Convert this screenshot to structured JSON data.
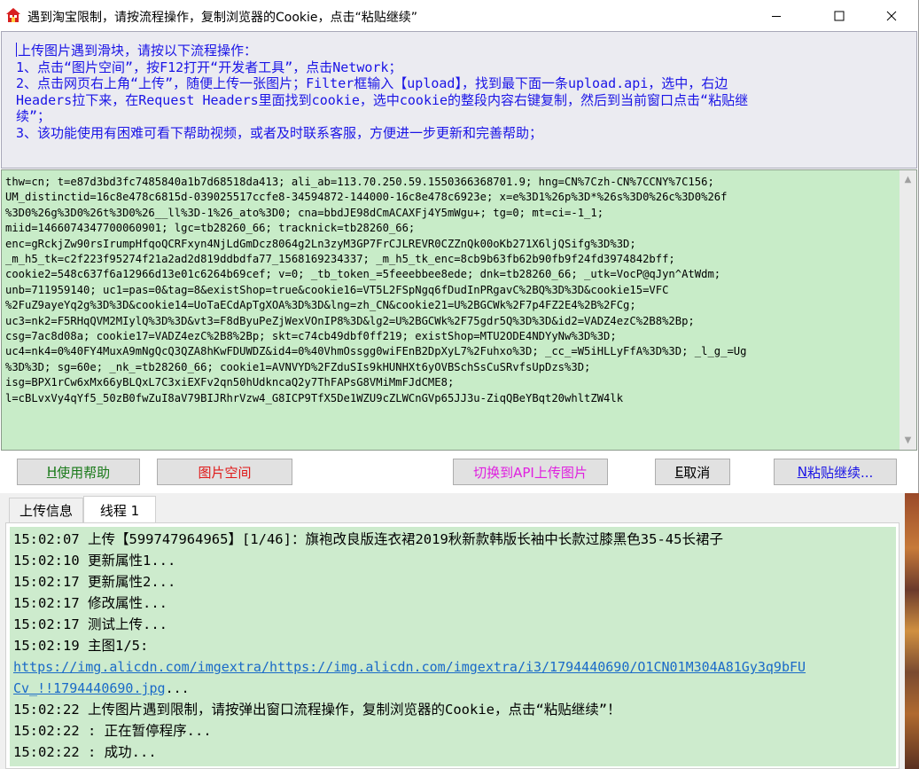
{
  "window": {
    "title": "遇到淘宝限制，请按流程操作，复制浏览器的Cookie，点击“粘贴继续”",
    "minimize_glyph": "—",
    "maximize_glyph": "☐",
    "close_glyph": "✕"
  },
  "instructions": {
    "line1": "上传图片遇到滑块，请按以下流程操作：",
    "line2": "1、点击“图片空间”，按F12打开“开发者工具”，点击Network；",
    "line3": "2、点击网页右上角“上传”，随便上传一张图片；Filter框输入【upload】，找到最下面一条upload.api，选中，右边",
    "line4": "Headers拉下来，在Request Headers里面找到cookie，选中cookie的整段内容右键复制，然后到当前窗口点击“粘贴继",
    "line5": "续”；",
    "line6": "3、该功能使用有困难可看下帮助视频，或者及时联系客服，方便进一步更新和完善帮助；"
  },
  "cookie_text": "thw=cn; t=e87d3bd3fc7485840a1b7d68518da413; ali_ab=113.70.250.59.1550366368701.9; hng=CN%7Czh-CN%7CCNY%7C156;\nUM_distinctid=16c8e478c6815d-039025517ccfe8-34594872-144000-16c8e478c6923e; x=e%3D1%26p%3D*%26s%3D0%26c%3D0%26f\n%3D0%26g%3D0%26t%3D0%26__ll%3D-1%26_ato%3D0; cna=bbdJE98dCmACAXFj4Y5mWgu+; tg=0; mt=ci=-1_1;\nmiid=1466074347700060901; lgc=tb28260_66; tracknick=tb28260_66;\nenc=gRckjZw90rsIrumpHfqoQCRFxyn4NjLdGmDcz8064g2Ln3zyM3GP7FrCJLREVR0CZZnQk00oKb271X6ljQSifg%3D%3D;\n_m_h5_tk=c2f223f95274f21a2ad2d819ddbdfa77_1568169234337; _m_h5_tk_enc=8cb9b63fb62b90fb9f24fd3974842bff;\ncookie2=548c637f6a12966d13e01c6264b69cef; v=0; _tb_token_=5feeebbee8ede; dnk=tb28260_66; _utk=VocP@qJyn^AtWdm;\nunb=711959140; uc1=pas=0&tag=8&existShop=true&cookie16=VT5L2FSpNgq6fDudInPRgavC%2BQ%3D%3D&cookie15=VFC\n%2FuZ9ayeYq2g%3D%3D&cookie14=UoTaECdApTgXOA%3D%3D&lng=zh_CN&cookie21=U%2BGCWk%2F7p4FZ2E4%2B%2FCg;\nuc3=nk2=F5RHqQVM2MIylQ%3D%3D&vt3=F8dByuPeZjWexVOnIP8%3D&lg2=U%2BGCWk%2F75gdr5Q%3D%3D&id2=VADZ4ezC%2B8%2Bp;\ncsg=7ac8d08a; cookie17=VADZ4ezC%2B8%2Bp; skt=c74cb49dbf0ff219; existShop=MTU2ODE4NDYyNw%3D%3D;\nuc4=nk4=0%40FY4MuxA9mNgQcQ3QZA8hKwFDUWDZ&id4=0%40VhmOssgg0wiFEnB2DpXyL7%2Fuhxo%3D; _cc_=W5iHLLyFfA%3D%3D; _l_g_=Ug\n%3D%3D; sg=60e; _nk_=tb28260_66; cookie1=AVNVYD%2FZduSIs9kHUNHXt6yOVBSchSsCuSRvfsUpDzs%3D;\nisg=BPX1rCw6xMx66yBLQxL7C3xiEXFv2qn50hUdkncaQ2y7ThFAPsG8VMiMmFJdCME8;\nl=cBLvxVy4qYf5_50zB0fwZuI8aV79BIJRhrVzw4_G8ICP9TfX5De1WZU9cZLWCnGVp65JJ3u-ZiqQBeYBqt20whltZW4lk",
  "buttons": {
    "help": {
      "hotkey": "H",
      "label": "使用帮助"
    },
    "picspace": {
      "label": "图片空间"
    },
    "switch_api": {
      "label": "切换到API上传图片"
    },
    "cancel": {
      "hotkey": "E",
      "label": "取消"
    },
    "paste": {
      "hotkey": "N",
      "label": "粘贴继续..."
    }
  },
  "tabs": [
    {
      "label": "上传信息"
    },
    {
      "label": "线程 1"
    }
  ],
  "log": [
    "15:02:07 上传【599747964965】[1/46]：旗袍改良版连衣裙2019秋新款韩版长袖中长款过膝黑色35-45长裙子",
    "15:02:10 更新属性1...",
    "15:02:17 更新属性2...",
    "15:02:17 修改属性...",
    "15:02:17 测试上传...",
    "15:02:19 主图1/5:"
  ],
  "log_link_line1": "https://img.alicdn.com/imgextra/https://img.alicdn.com/imgextra/i3/1794440690/O1CN01M304A81Gy3q9bFU",
  "log_link_line2": "Cv_!!1794440690.jpg",
  "log_link_suffix": "...",
  "log_after": [
    "15:02:22 上传图片遇到限制，请按弹出窗口流程操作，复制浏览器的Cookie，点击“粘贴继续”！",
    "15:02:22 : 正在暂停程序...",
    "15:02:22 : 成功..."
  ],
  "colors": {
    "instruction_text": "#1a14e6",
    "cookie_bg": "#c8ecc8",
    "log_bg": "#cdebcd",
    "help_text": "#1a7a1a",
    "picspace_text": "#e01818",
    "switch_text": "#e020e0",
    "paste_text": "#1a14e6",
    "link": "#1a6ac8"
  },
  "icons": [
    "house-app-icon",
    "minimize-icon",
    "maximize-icon",
    "close-icon",
    "scroll-up-icon",
    "scroll-down-icon"
  ]
}
